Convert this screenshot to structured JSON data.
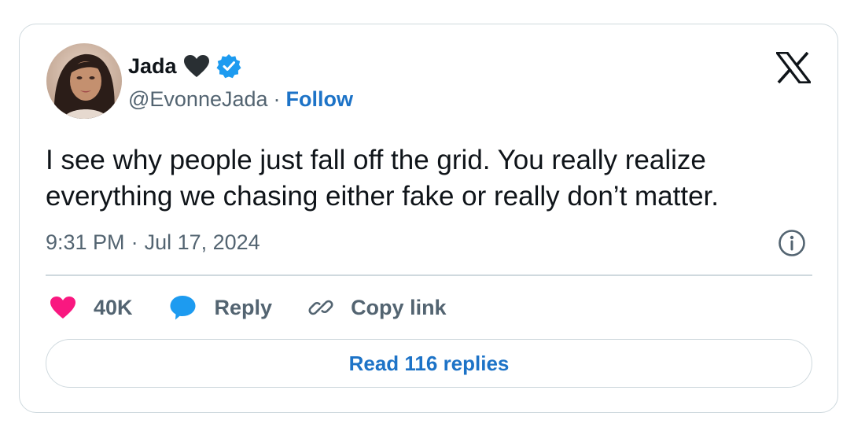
{
  "author": {
    "display_name": "Jada",
    "name_icon": "black-heart-icon",
    "verified_icon": "verified-badge-icon",
    "handle": "@EvonneJada",
    "separator": "·",
    "follow_label": "Follow"
  },
  "brand_icon": "x-logo-icon",
  "tweet": {
    "text": "I see why people just fall off the grid. You really realize everything we chasing either fake or really don’t matter.",
    "time": "9:31 PM",
    "separator": "·",
    "date": "Jul 17, 2024"
  },
  "actions": {
    "like_count": "40K",
    "reply_label": "Reply",
    "copy_link_label": "Copy link"
  },
  "read_replies_label": "Read 116 replies",
  "colors": {
    "link_blue": "#1d73c7",
    "verified_blue": "#1d9bf0",
    "like_pink": "#f91880",
    "muted_text": "#536471",
    "border": "#cfd9de"
  }
}
